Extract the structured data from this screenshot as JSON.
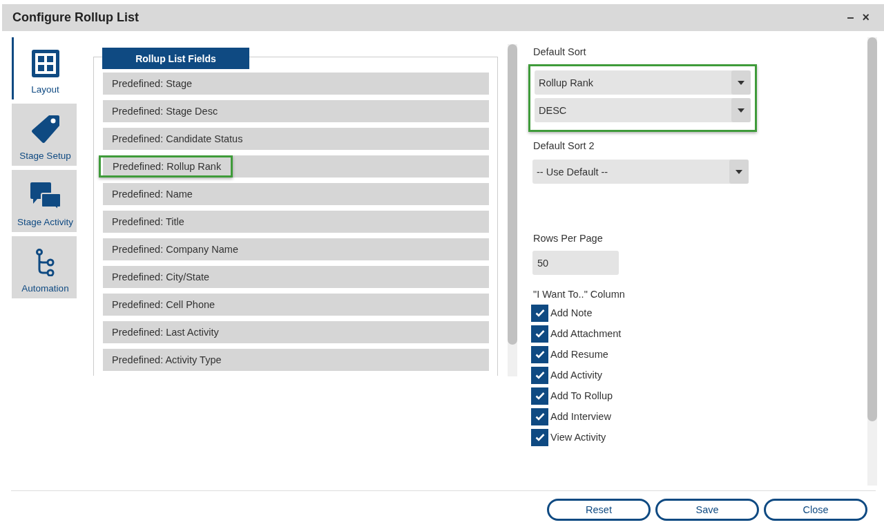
{
  "window": {
    "title": "Configure Rollup List",
    "controls": [
      "–",
      "×"
    ]
  },
  "sidebar": {
    "items": [
      {
        "label": "Layout",
        "selected": true
      },
      {
        "label": "Stage Setup",
        "selected": false
      },
      {
        "label": "Stage Activity",
        "selected": false
      },
      {
        "label": "Automation",
        "selected": false
      }
    ]
  },
  "fields_panel": {
    "header": "Rollup List Fields",
    "items": [
      {
        "label": "Predefined: Stage",
        "highlighted": false
      },
      {
        "label": "Predefined: Stage Desc",
        "highlighted": false
      },
      {
        "label": "Predefined: Candidate Status",
        "highlighted": false
      },
      {
        "label": "Predefined: Rollup Rank",
        "highlighted": true
      },
      {
        "label": "Predefined: Name",
        "highlighted": false
      },
      {
        "label": "Predefined: Title",
        "highlighted": false
      },
      {
        "label": "Predefined: Company Name",
        "highlighted": false
      },
      {
        "label": "Predefined: City/State",
        "highlighted": false
      },
      {
        "label": "Predefined: Cell Phone",
        "highlighted": false
      },
      {
        "label": "Predefined: Last Activity",
        "highlighted": false
      },
      {
        "label": "Predefined: Activity Type",
        "highlighted": false
      }
    ]
  },
  "settings": {
    "default_sort": {
      "label": "Default Sort",
      "highlighted": true,
      "selects": [
        "Rollup Rank",
        "DESC"
      ]
    },
    "default_sort_2": {
      "label": "Default Sort 2",
      "selects": [
        "-- Use Default --"
      ]
    },
    "rows_per_page": {
      "label": "Rows Per Page",
      "value": "50"
    },
    "i_want_to": {
      "label": "\"I Want To..\" Column",
      "options": [
        {
          "label": "Add Note",
          "checked": true
        },
        {
          "label": "Add Attachment",
          "checked": true
        },
        {
          "label": "Add Resume",
          "checked": true
        },
        {
          "label": "Add Activity",
          "checked": true
        },
        {
          "label": "Add To Rollup",
          "checked": true
        },
        {
          "label": "Add Interview",
          "checked": true
        },
        {
          "label": "View Activity",
          "checked": true
        }
      ]
    }
  },
  "buttons": [
    "Reset",
    "Save",
    "Close"
  ]
}
